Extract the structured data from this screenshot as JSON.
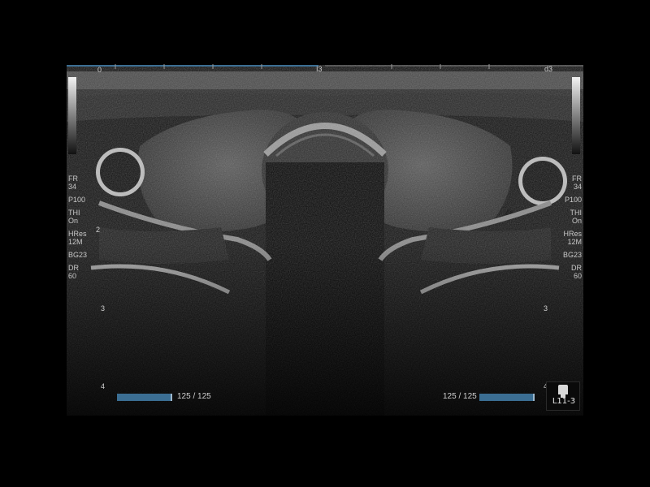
{
  "ruler": {
    "left_depth": "0",
    "left_marker": "I3",
    "right_marker": "d3"
  },
  "params_left": [
    "FR",
    "34",
    "P100",
    "THI",
    "On",
    "HRes",
    "12M",
    "BG23",
    "DR",
    "60"
  ],
  "params_right": [
    "FR",
    "34",
    "P100",
    "THI",
    "On",
    "HRes",
    "12M",
    "BG23",
    "DR",
    "60"
  ],
  "depth_left": [
    "2",
    "3",
    "4"
  ],
  "depth_right": [
    "3",
    "4"
  ],
  "frames": {
    "left": "125 / 125",
    "right": "125 / 125"
  },
  "probe": {
    "name": "L11-3"
  },
  "colors": {
    "accent": "#3b6e93",
    "background": "#000000"
  }
}
